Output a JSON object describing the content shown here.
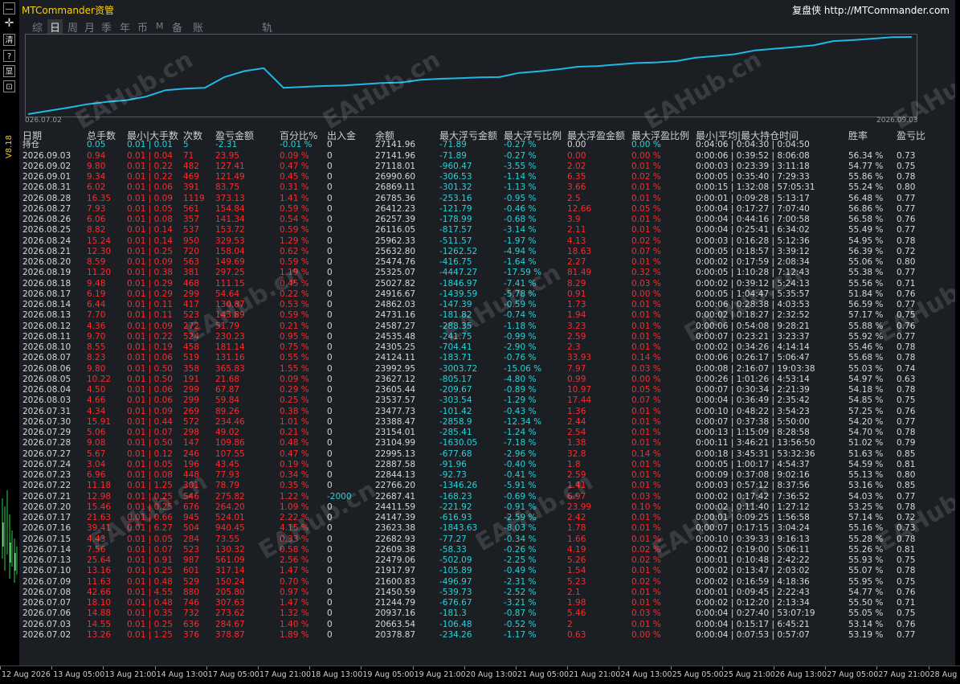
{
  "app": {
    "title": "MTCommander资管",
    "brand": "复盘侠 http://MTCommander.com",
    "version": "V8.18",
    "watermark": "EAHub.cn"
  },
  "leftbar": {
    "buttons": [
      "—",
      "✛",
      "清",
      "?",
      "显",
      "⊡"
    ]
  },
  "tabs": [
    {
      "label": "综",
      "active": false
    },
    {
      "label": "日",
      "active": true
    },
    {
      "label": "周",
      "active": false
    },
    {
      "label": "月",
      "active": false
    },
    {
      "label": "季",
      "active": false
    },
    {
      "label": "年",
      "active": false
    },
    {
      "label": "币",
      "active": false
    },
    {
      "label": "M",
      "active": false
    },
    {
      "label": "备",
      "active": false
    },
    {
      "label": "账户",
      "active": false
    },
    {
      "label": "轨迹",
      "active": false
    }
  ],
  "chart_data": {
    "type": "line",
    "x_start_label": "026.07.02",
    "x_end_label": "2026.09.03",
    "color": "#21b8e8",
    "x": [
      "2026.07.02",
      "2026.07.03",
      "2026.07.06",
      "2026.07.07",
      "2026.07.08",
      "2026.07.09",
      "2026.07.10",
      "2026.07.13",
      "2026.07.14",
      "2026.07.15",
      "2026.07.16",
      "2026.07.17",
      "2026.07.20",
      "2026.07.21",
      "2026.07.22",
      "2026.07.23",
      "2026.07.24",
      "2026.07.27",
      "2026.07.28",
      "2026.07.29",
      "2026.07.30",
      "2026.07.31",
      "2026.08.03",
      "2026.08.04",
      "2026.08.05",
      "2026.08.06",
      "2026.08.07",
      "2026.08.10",
      "2026.08.11",
      "2026.08.12",
      "2026.08.13",
      "2026.08.14",
      "2026.08.17",
      "2026.08.18",
      "2026.08.19",
      "2026.08.20",
      "2026.08.21",
      "2026.08.24",
      "2026.08.25",
      "2026.08.26",
      "2026.08.27",
      "2026.08.28",
      "2026.08.31",
      "2026.09.01",
      "2026.09.02",
      "2026.09.03"
    ],
    "values": [
      20378.87,
      20663.54,
      20937.16,
      21244.79,
      21450.59,
      21600.83,
      21917.97,
      22479.06,
      22609.38,
      22682.93,
      23623.38,
      24147.39,
      24411.59,
      22687.41,
      22766.2,
      22844.13,
      22887.58,
      22995.13,
      23104.99,
      23154.01,
      23388.47,
      23477.73,
      23537.57,
      23605.44,
      23627.12,
      23992.95,
      24124.11,
      24305.25,
      24535.48,
      24587.27,
      24731.16,
      24862.03,
      24916.67,
      25027.82,
      25325.07,
      25474.76,
      25632.8,
      25962.33,
      26116.05,
      26257.39,
      26412.23,
      26785.36,
      26869.11,
      26990.6,
      27118.01,
      27141.96
    ]
  },
  "table": {
    "headers": [
      "日期",
      "总手数",
      "最小|大手数",
      "次数",
      "盈亏金额",
      "百分比%",
      "出入金",
      "余额",
      "最大浮亏金额",
      "最大浮亏比例",
      "最大浮盈金额",
      "最大浮盈比例",
      "最小|平均|最大持仓时间",
      "胜率",
      "盈亏比"
    ],
    "summary": [
      "持仓",
      "0.05",
      "0.01 | 0.01",
      "5",
      "-2.31",
      "-0.01 %",
      "0",
      "27141.96",
      "-71.89",
      "-0.27 %",
      "0.00",
      "0.00 %",
      "0:04:06 | 0:04:30 | 0:04:50",
      "",
      ""
    ],
    "rows": [
      [
        "2026.09.03",
        "0.94",
        "0.01 | 0.04",
        "71",
        "23.95",
        "0.09 %",
        "0",
        "27141.96",
        "-71.89",
        "-0.27 %",
        "0.00",
        "0.00 %",
        "0:00:06 | 0:39:52 | 8:06:08",
        "56.34 %",
        "0.73"
      ],
      [
        "2026.09.02",
        "9.80",
        "0.01 | 0.22",
        "482",
        "127.41",
        "0.47 %",
        "0",
        "27118.01",
        "-960.47",
        "-3.55 %",
        "2.02",
        "0.01 %",
        "0:00:03 | 0:23:39 | 3:11:18",
        "54.77 %",
        "0.75"
      ],
      [
        "2026.09.01",
        "9.34",
        "0.01 | 0.22",
        "469",
        "121.49",
        "0.45 %",
        "0",
        "26990.60",
        "-306.53",
        "-1.14 %",
        "6.35",
        "0.02 %",
        "0:00:05 | 0:35:40 | 7:29:33",
        "55.86 %",
        "0.78"
      ],
      [
        "2026.08.31",
        "6.02",
        "0.01 | 0.06",
        "391",
        "83.75",
        "0.31 %",
        "0",
        "26869.11",
        "-301.32",
        "-1.13 %",
        "3.66",
        "0.01 %",
        "0:00:15 | 1:32:08 | 57:05:31",
        "55.24 %",
        "0.80"
      ],
      [
        "2026.08.28",
        "16.35",
        "0.01 | 0.09",
        "1119",
        "373.13",
        "1.41 %",
        "0",
        "26785.36",
        "-253.16",
        "-0.95 %",
        "2.5",
        "0.01 %",
        "0:00:01 | 0:09:28 | 5:13:17",
        "56.48 %",
        "0.77"
      ],
      [
        "2026.08.27",
        "7.93",
        "0.01 | 0.05",
        "561",
        "154.84",
        "0.59 %",
        "0",
        "26412.23",
        "-121.79",
        "-0.46 %",
        "12.66",
        "0.05 %",
        "0:00:04 | 0:17:27 | 7:07:40",
        "56.86 %",
        "0.77"
      ],
      [
        "2026.08.26",
        "6.06",
        "0.01 | 0.08",
        "357",
        "141.34",
        "0.54 %",
        "0",
        "26257.39",
        "-178.99",
        "-0.68 %",
        "3.9",
        "0.01 %",
        "0:00:04 | 0:44:16 | 7:00:58",
        "56.58 %",
        "0.76"
      ],
      [
        "2026.08.25",
        "8.82",
        "0.01 | 0.14",
        "537",
        "153.72",
        "0.59 %",
        "0",
        "26116.05",
        "-817.57",
        "-3.14 %",
        "2.11",
        "0.01 %",
        "0:00:04 | 0:25:41 | 6:34:02",
        "55.49 %",
        "0.77"
      ],
      [
        "2026.08.24",
        "15.24",
        "0.01 | 0.14",
        "950",
        "329.53",
        "1.29 %",
        "0",
        "25962.33",
        "-511.57",
        "-1.97 %",
        "4.13",
        "0.02 %",
        "0:00:03 | 0:16:28 | 5:12:36",
        "54.95 %",
        "0.78"
      ],
      [
        "2026.08.21",
        "12.30",
        "0.01 | 0.25",
        "720",
        "158.04",
        "0.62 %",
        "0",
        "25632.80",
        "-1262.52",
        "-4.94 %",
        "18.63",
        "0.07 %",
        "0:00:05 | 0:18:57 | 3:39:12",
        "56.39 %",
        "0.72"
      ],
      [
        "2026.08.20",
        "8.59",
        "0.01 | 0.09",
        "563",
        "149.69",
        "0.59 %",
        "0",
        "25474.76",
        "-416.75",
        "-1.64 %",
        "2.27",
        "0.01 %",
        "0:00:02 | 0:17:59 | 2:08:34",
        "55.06 %",
        "0.80"
      ],
      [
        "2026.08.19",
        "11.20",
        "0.01 | 0.38",
        "381",
        "297.25",
        "1.19 %",
        "0",
        "25325.07",
        "-4447.27",
        "-17.59 %",
        "81.49",
        "0.32 %",
        "0:00:05 | 1:10:28 | 7:12:43",
        "55.38 %",
        "0.77"
      ],
      [
        "2026.08.18",
        "9.48",
        "0.01 | 0.29",
        "468",
        "111.15",
        "0.45 %",
        "0",
        "25027.82",
        "-1846.97",
        "-7.41 %",
        "8.29",
        "0.03 %",
        "0:00:02 | 0:39:12 | 5:24:13",
        "55.56 %",
        "0.71"
      ],
      [
        "2026.08.17",
        "6.19",
        "0.01 | 0.29",
        "299",
        "54.64",
        "0.22 %",
        "0",
        "24916.67",
        "-1439.59",
        "-5.78 %",
        "0.91",
        "0.00 %",
        "0:00:05 | 1:04:47 | 5:35:57",
        "51.84 %",
        "0.76"
      ],
      [
        "2026.08.14",
        "6.44",
        "0.01 | 0.11",
        "417",
        "130.87",
        "0.53 %",
        "0",
        "24862.03",
        "-147.39",
        "-0.59 %",
        "1.73",
        "0.01 %",
        "0:00:06 | 0:28:38 | 4:03:53",
        "56.59 %",
        "0.77"
      ],
      [
        "2026.08.13",
        "7.70",
        "0.01 | 0.11",
        "523",
        "143.89",
        "0.59 %",
        "0",
        "24731.16",
        "-181.82",
        "-0.74 %",
        "1.94",
        "0.01 %",
        "0:00:02 | 0:18:27 | 2:32:52",
        "57.17 %",
        "0.75"
      ],
      [
        "2026.08.12",
        "4.36",
        "0.01 | 0.09",
        "272",
        "51.79",
        "0.21 %",
        "0",
        "24587.27",
        "-288.35",
        "-1.18 %",
        "3.23",
        "0.01 %",
        "0:00:06 | 0:54:08 | 9:28:21",
        "55.88 %",
        "0.76"
      ],
      [
        "2026.08.11",
        "9.70",
        "0.01 | 0.22",
        "524",
        "230.23",
        "0.95 %",
        "0",
        "24535.48",
        "-241.75",
        "-0.99 %",
        "2.59",
        "0.01 %",
        "0:00:07 | 0:23:21 | 3:23:37",
        "55.92 %",
        "0.77"
      ],
      [
        "2026.08.10",
        "8.55",
        "0.01 | 0.19",
        "458",
        "181.14",
        "0.75 %",
        "0",
        "24305.25",
        "-704.41",
        "-2.90 %",
        "2.3",
        "0.01 %",
        "0:00:02 | 0:34:26 | 4:14:14",
        "55.46 %",
        "0.78"
      ],
      [
        "2026.08.07",
        "8.23",
        "0.01 | 0.06",
        "519",
        "131.16",
        "0.55 %",
        "0",
        "24124.11",
        "-183.71",
        "-0.76 %",
        "33.93",
        "0.14 %",
        "0:00:06 | 0:26:17 | 5:06:47",
        "55.68 %",
        "0.78"
      ],
      [
        "2026.08.06",
        "9.80",
        "0.01 | 0.50",
        "358",
        "365.83",
        "1.55 %",
        "0",
        "23992.95",
        "-3003.72",
        "-15.06 %",
        "7.97",
        "0.03 %",
        "0:00:08 | 2:16:07 | 19:03:38",
        "55.03 %",
        "0.74"
      ],
      [
        "2026.08.05",
        "10.22",
        "0.01 | 0.50",
        "191",
        "21.68",
        "0.09 %",
        "0",
        "23627.12",
        "-805.17",
        "-4.80 %",
        "0.99",
        "0.00 %",
        "0:00:26 | 1:01:26 | 4:53:14",
        "54.97 %",
        "0.63"
      ],
      [
        "2026.08.04",
        "4.50",
        "0.01 | 0.06",
        "299",
        "67.87",
        "0.29 %",
        "0",
        "23605.44",
        "-209.67",
        "-0.89 %",
        "10.97",
        "0.05 %",
        "0:00:07 | 0:30:34 | 2:21:39",
        "54.18 %",
        "0.78"
      ],
      [
        "2026.08.03",
        "4.66",
        "0.01 | 0.06",
        "299",
        "59.84",
        "0.25 %",
        "0",
        "23537.57",
        "-303.54",
        "-1.29 %",
        "17.44",
        "0.07 %",
        "0:00:04 | 0:36:49 | 2:35:42",
        "54.85 %",
        "0.75"
      ],
      [
        "2026.07.31",
        "4.34",
        "0.01 | 0.09",
        "269",
        "89.26",
        "0.38 %",
        "0",
        "23477.73",
        "-101.42",
        "-0.43 %",
        "1.36",
        "0.01 %",
        "0:00:10 | 0:48:22 | 3:54:23",
        "57.25 %",
        "0.76"
      ],
      [
        "2026.07.30",
        "15.91",
        "0.01 | 0.44",
        "572",
        "234.46",
        "1.01 %",
        "0",
        "23388.47",
        "-2858.9",
        "-12.34 %",
        "2.44",
        "0.01 %",
        "0:00:07 | 0:37:38 | 5:50:00",
        "54.20 %",
        "0.77"
      ],
      [
        "2026.07.29",
        "5.06",
        "0.01 | 0.07",
        "298",
        "49.02",
        "0.21 %",
        "0",
        "23154.01",
        "-285.41",
        "-1.24 %",
        "2.54",
        "0.01 %",
        "0:00:13 | 1:15:09 | 8:28:58",
        "54.70 %",
        "0.78"
      ],
      [
        "2026.07.28",
        "9.08",
        "0.01 | 0.50",
        "147",
        "109.86",
        "0.48 %",
        "0",
        "23104.99",
        "-1630.05",
        "-7.18 %",
        "1.38",
        "0.01 %",
        "0:00:11 | 3:46:21 | 13:56:50",
        "51.02 %",
        "0.79"
      ],
      [
        "2026.07.27",
        "5.67",
        "0.01 | 0.12",
        "246",
        "107.55",
        "0.47 %",
        "0",
        "22995.13",
        "-677.68",
        "-2.96 %",
        "32.8",
        "0.14 %",
        "0:00:18 | 3:45:31 | 53:32:36",
        "51.63 %",
        "0.85"
      ],
      [
        "2026.07.24",
        "3.04",
        "0.01 | 0.05",
        "196",
        "43.45",
        "0.19 %",
        "0",
        "22887.58",
        "-91.96",
        "-0.40 %",
        "1.8",
        "0.01 %",
        "0:00:05 | 1:00:17 | 4:54:37",
        "54.59 %",
        "0.81"
      ],
      [
        "2026.07.23",
        "6.96",
        "0.01 | 0.08",
        "448",
        "77.93",
        "0.34 %",
        "0",
        "22844.13",
        "-92.73",
        "-0.41 %",
        "2.59",
        "0.01 %",
        "0:00:09 | 0:37:08 | 9:02:16",
        "55.13 %",
        "0.80"
      ],
      [
        "2026.07.22",
        "11.18",
        "0.01 | 1.25",
        "301",
        "78.79",
        "0.35 %",
        "0",
        "22766.20",
        "-1346.26",
        "-5.91 %",
        "1.41",
        "0.01 %",
        "0:00:03 | 0:57:12 | 8:37:56",
        "53.16 %",
        "0.85"
      ],
      [
        "2026.07.21",
        "12.98",
        "0.01 | 0.25",
        "546",
        "275.82",
        "1.22 %",
        "-2000",
        "22687.41",
        "-168.23",
        "-0.69 %",
        "6.97",
        "0.03 %",
        "0:00:02 | 0:17:42 | 7:36:52",
        "54.03 %",
        "0.77"
      ],
      [
        "2026.07.20",
        "15.46",
        "0.01 | 0.25",
        "676",
        "264.20",
        "1.09 %",
        "0",
        "24411.59",
        "-221.92",
        "-0.91 %",
        "23.99",
        "0.10 %",
        "0:00:02 | 0:11:40 | 1:27:12",
        "53.25 %",
        "0.78"
      ],
      [
        "2026.07.17",
        "21.63",
        "0.01 | 0.66",
        "945",
        "524.01",
        "2.22 %",
        "0",
        "24147.39",
        "-616.93",
        "-2.59 %",
        "2.42",
        "0.01 %",
        "0:00:01 | 0:09:25 | 1:56:58",
        "57.14 %",
        "0.72"
      ],
      [
        "2026.07.16",
        "39.41",
        "0.01 | 6.27",
        "504",
        "940.45",
        "4.15 %",
        "0",
        "23623.38",
        "-1843.63",
        "-8.03 %",
        "1.78",
        "0.01 %",
        "0:00:07 | 0:17:15 | 3:04:24",
        "55.16 %",
        "0.73"
      ],
      [
        "2026.07.15",
        "4.43",
        "0.01 | 0.05",
        "284",
        "73.55",
        "0.33 %",
        "0",
        "22682.93",
        "-77.27",
        "-0.34 %",
        "1.66",
        "0.01 %",
        "0:00:10 | 0:39:33 | 9:16:13",
        "55.28 %",
        "0.78"
      ],
      [
        "2026.07.14",
        "7.56",
        "0.01 | 0.07",
        "523",
        "130.32",
        "0.58 %",
        "0",
        "22609.38",
        "-58.33",
        "-0.26 %",
        "4.19",
        "0.02 %",
        "0:00:02 | 0:19:00 | 5:06:11",
        "55.26 %",
        "0.81"
      ],
      [
        "2026.07.13",
        "25.64",
        "0.01 | 0.91",
        "987",
        "561.09",
        "2.56 %",
        "0",
        "22479.06",
        "-502.09",
        "-2.25 %",
        "5.26",
        "0.02 %",
        "0:00:01 | 0:10:48 | 2:42:22",
        "55.93 %",
        "0.75"
      ],
      [
        "2026.07.10",
        "13.16",
        "0.01 | 0.25",
        "601",
        "317.14",
        "1.47 %",
        "0",
        "21917.97",
        "-105.89",
        "-0.49 %",
        "1.54",
        "0.01 %",
        "0:00:02 | 0:13:47 | 2:03:02",
        "55.07 %",
        "0.78"
      ],
      [
        "2026.07.09",
        "11.63",
        "0.01 | 0.48",
        "529",
        "150.24",
        "0.70 %",
        "0",
        "21600.83",
        "-496.97",
        "-2.31 %",
        "5.23",
        "0.02 %",
        "0:00:02 | 0:16:59 | 4:18:36",
        "55.95 %",
        "0.75"
      ],
      [
        "2026.07.08",
        "42.66",
        "0.01 | 4.55",
        "880",
        "205.80",
        "0.97 %",
        "0",
        "21450.59",
        "-539.73",
        "-2.52 %",
        "2.1",
        "0.01 %",
        "0:00:01 | 0:09:45 | 2:22:43",
        "54.77 %",
        "0.76"
      ],
      [
        "2026.07.07",
        "18.10",
        "0.01 | 0.48",
        "746",
        "307.63",
        "1.47 %",
        "0",
        "21244.79",
        "-676.67",
        "-3.21 %",
        "1.98",
        "0.01 %",
        "0:00:02 | 0:12:20 | 2:13:34",
        "55.50 %",
        "0.71"
      ],
      [
        "2026.07.06",
        "14.88",
        "0.01 | 0.35",
        "732",
        "273.62",
        "1.32 %",
        "0",
        "20937.16",
        "-181.3",
        "-0.87 %",
        "5.46",
        "0.03 %",
        "0:00:04 | 0:27:40 | 53:07:19",
        "55.05 %",
        "0.75"
      ],
      [
        "2026.07.03",
        "14.55",
        "0.01 | 0.25",
        "636",
        "284.67",
        "1.40 %",
        "0",
        "20663.54",
        "-106.48",
        "-0.52 %",
        "2",
        "0.01 %",
        "0:00:04 | 0:15:17 | 6:45:21",
        "53.14 %",
        "0.76"
      ],
      [
        "2026.07.02",
        "13.26",
        "0.01 | 1.25",
        "376",
        "378.87",
        "1.89 %",
        "0",
        "20378.87",
        "-234.26",
        "-1.17 %",
        "0.63",
        "0.00 %",
        "0:00:04 | 0:07:53 | 0:57:07",
        "53.19 %",
        "0.77"
      ]
    ]
  },
  "bottom_axis": [
    "12 Aug 2026",
    "13 Aug 05:00",
    "13 Aug 21:00",
    "14 Aug 13:00",
    "17 Aug 05:00",
    "17 Aug 21:00",
    "18 Aug 13:00",
    "19 Aug 05:00",
    "19 Aug 21:00",
    "20 Aug 13:00",
    "21 Aug 05:00",
    "21 Aug 21:00",
    "24 Aug 13:00",
    "25 Aug 05:00",
    "25 Aug 21:00",
    "26 Aug 13:00",
    "27 Aug 05:00",
    "27 Aug 21:00",
    "28 Aug 13:00"
  ],
  "colors": {
    "panel_bg": "#1b1e23",
    "positive_text": "#ff2a2a",
    "negative_text": "#27d3da",
    "curve": "#21b8e8",
    "title": "#ffd200"
  }
}
